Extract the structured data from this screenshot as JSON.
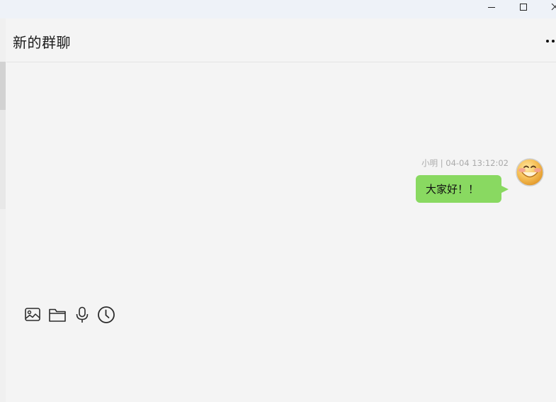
{
  "window": {
    "minimize_icon": "minimize-icon",
    "maximize_icon": "maximize-icon",
    "close_icon": "close-icon"
  },
  "header": {
    "title": "新的群聊",
    "more_icon": "more-icon"
  },
  "messages": [
    {
      "sender": "小明",
      "time": "04-04 13:12:02",
      "meta": "小明 | 04-04 13:12:02",
      "text": "大家好！！",
      "avatar": "smiley-avatar",
      "bubble_color": "#89d961"
    }
  ],
  "toolbar": {
    "icons": [
      "image-icon",
      "folder-icon",
      "microphone-icon",
      "clock-icon"
    ]
  },
  "colors": {
    "background": "#f4f4f4",
    "titlebar": "#eef2f8",
    "bubble": "#89d961"
  }
}
